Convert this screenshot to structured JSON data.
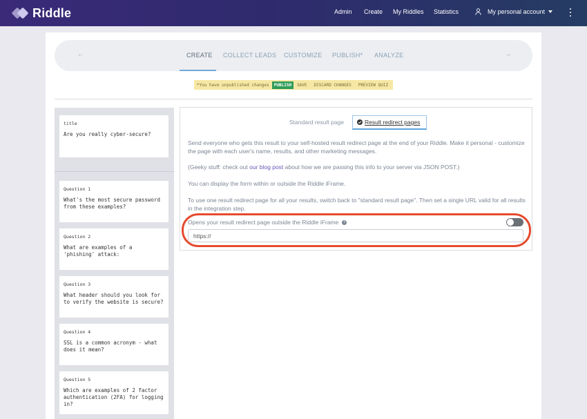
{
  "app": {
    "name": "Riddle"
  },
  "topnav": {
    "items": [
      "Admin",
      "Create",
      "My Riddles",
      "Statistics"
    ],
    "account": "My personal account"
  },
  "steps": {
    "prev_arrow": "←",
    "next_arrow": "→",
    "items": [
      "CREATE",
      "COLLECT LEADS",
      "CUSTOMIZE",
      "PUBLISH*",
      "ANALYZE"
    ],
    "active": "CREATE"
  },
  "notice": {
    "text": "*You have unpublished changes",
    "publish": "PUBLISH",
    "save": "SAVE",
    "discard": "DISCARD CHANGES",
    "preview": "PREVIEW QUIZ"
  },
  "sidebar": {
    "title_card": {
      "label": "title",
      "text": "Are you really cyber-secure?"
    },
    "questions": [
      {
        "label": "Question 1",
        "text": "What's the most secure password from these examples?"
      },
      {
        "label": "Question 2",
        "text": "What are examples of a 'phishing' attack:"
      },
      {
        "label": "Question 3",
        "text": "What header should you look for to verify the website is secure?"
      },
      {
        "label": "Question 4",
        "text": "SSL is a common acronym - what does it mean?"
      },
      {
        "label": "Question 5",
        "text": "Which are examples of 2 factor authentication (2FA) for logging in?"
      }
    ]
  },
  "result": {
    "tab_standard": "Standard result page",
    "tab_redirect": "Result redirect pages",
    "para1": "Send everyone who gets this result to your self-hosted result redirect page at the end of your Riddle. Make it personal - customize the page with each user's name, results, and other marketing messages.",
    "para2_before": "(Geeky stuff: check out ",
    "para2_link": "our blog post",
    "para2_after": " about how we are passing this info to your server via JSON POST.)",
    "para3": "You can display the form within or outside the Riddle iFrame.",
    "para4": "To use one result redirect page for all your results, switch back to \"standard result page\". Then set a single URL valid for all results in the integration step.",
    "toggle_label": "Opens your result redirect page outside the Riddle iFrame",
    "toggle_on": false,
    "url_placeholder": "https://"
  },
  "colors": {
    "navbar_start": "#3a2a78",
    "navbar_end": "#253c63",
    "highlight": "#e64a2e",
    "publish_green": "#2f9c58",
    "notice_yellow": "#f6e8a4",
    "link_purple": "#6a55b8"
  }
}
